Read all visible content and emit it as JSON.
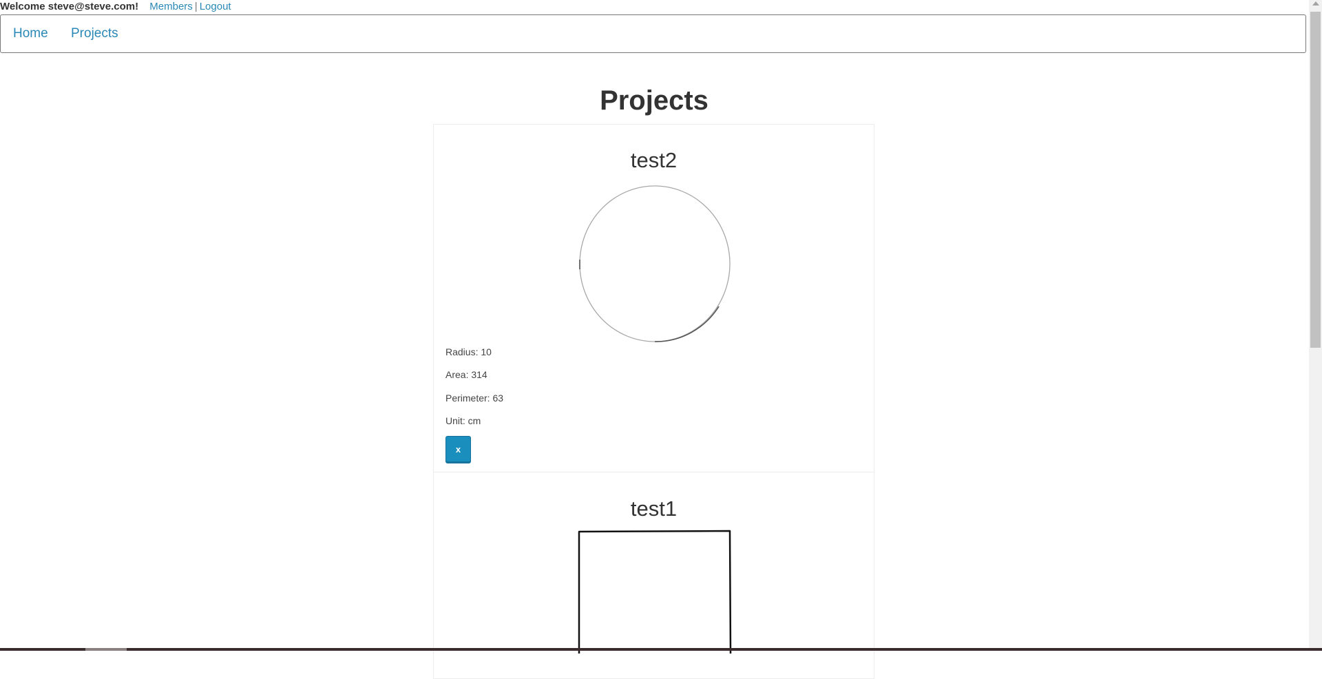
{
  "header": {
    "welcome_text": "Welcome steve@steve.com!",
    "members_link": "Members",
    "separator": "|",
    "logout_link": "Logout"
  },
  "nav": {
    "items": [
      {
        "label": "Home"
      },
      {
        "label": "Projects"
      }
    ]
  },
  "page": {
    "title": "Projects"
  },
  "projects": [
    {
      "name": "test2",
      "shape": "circle",
      "radius_text": "Radius: 10",
      "area_text": "Area: 314",
      "perimeter_text": "Perimeter: 63",
      "unit_text": "Unit: cm",
      "delete_label": "x"
    },
    {
      "name": "test1",
      "shape": "rectangle"
    }
  ],
  "colors": {
    "link": "#2a88b6",
    "button": "#1a8fbe",
    "text": "#333333"
  }
}
